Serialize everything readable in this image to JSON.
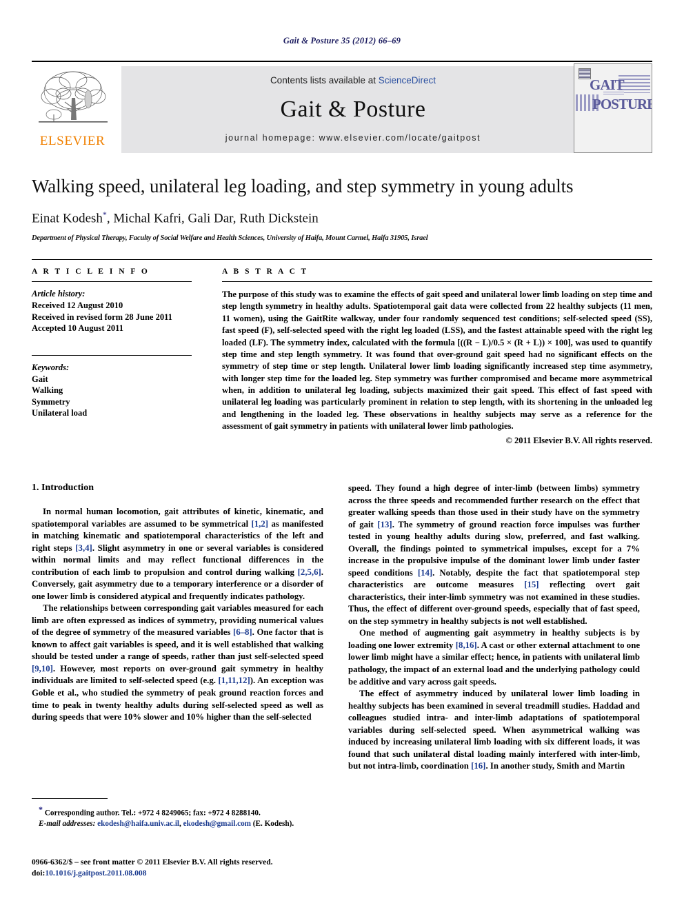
{
  "running_head": "Gait & Posture 35 (2012) 66–69",
  "masthead": {
    "contents_prefix": "Contents lists available at ",
    "sciencedirect": "ScienceDirect",
    "journal_title": "Gait & Posture",
    "homepage": "journal homepage: www.elsevier.com/locate/gaitpost",
    "publisher_wordmark": "ELSEVIER",
    "cover_title_line1": "GAIT",
    "cover_title_line2": "POSTURE",
    "accent_orange": "#f08000",
    "link_blue": "#2a4fa0",
    "band_gray": "#e4e4e6",
    "cover_purple": "#5a5a9a"
  },
  "article": {
    "title": "Walking speed, unilateral leg loading, and step symmetry in young adults",
    "authors": "Einat Kodesh",
    "authors_rest": ", Michal Kafri, Gali Dar, Ruth Dickstein",
    "affiliation": "Department of Physical Therapy, Faculty of Social Welfare and Health Sciences, University of Haifa, Mount Carmel, Haifa 31905, Israel"
  },
  "info": {
    "heading": "A R T I C L E    I N F O",
    "history_label": "Article history:",
    "history": [
      "Received 12 August 2010",
      "Received in revised form 28 June 2011",
      "Accepted 10 August 2011"
    ],
    "keywords_label": "Keywords:",
    "keywords": [
      "Gait",
      "Walking",
      "Symmetry",
      "Unilateral load"
    ]
  },
  "abstract": {
    "heading": "A B S T R A C T",
    "text": "The purpose of this study was to examine the effects of gait speed and unilateral lower limb loading on step time and step length symmetry in healthy adults. Spatiotemporal gait data were collected from 22 healthy subjects (11 men, 11 women), using the GaitRite walkway, under four randomly sequenced test conditions; self-selected speed (SS), fast speed (F), self-selected speed with the right leg loaded (LSS), and the fastest attainable speed with the right leg loaded (LF). The symmetry index, calculated with the formula [((R − L)/0.5 × (R + L)) × 100], was used to quantify step time and step length symmetry. It was found that over-ground gait speed had no significant effects on the symmetry of step time or step length. Unilateral lower limb loading significantly increased step time asymmetry, with longer step time for the loaded leg. Step symmetry was further compromised and became more asymmetrical when, in addition to unilateral leg loading, subjects maximized their gait speed. This effect of fast speed with unilateral leg loading was particularly prominent in relation to step length, with its shortening in the unloaded leg and lengthening in the loaded leg. These observations in healthy subjects may serve as a reference for the assessment of gait symmetry in patients with unilateral lower limb pathologies.",
    "copyright": "© 2011 Elsevier B.V. All rights reserved."
  },
  "body": {
    "section_heading": "1. Introduction",
    "left_paragraphs": [
      {
        "segments": [
          {
            "t": "In normal human locomotion, gait attributes of kinetic, kinematic, and spatiotemporal variables are assumed to be symmetrical "
          },
          {
            "t": "[1,2]",
            "ref": true
          },
          {
            "t": " as manifested in matching kinematic and spatiotemporal characteristics of the left and right steps "
          },
          {
            "t": "[3,4]",
            "ref": true
          },
          {
            "t": ". Slight asymmetry in one or several variables is considered within normal limits and may reflect functional differences in the contribution of each limb to propulsion and control during walking "
          },
          {
            "t": "[2,5,6]",
            "ref": true
          },
          {
            "t": ". Conversely, gait asymmetry due to a temporary interference or a disorder of one lower limb is considered atypical and frequently indicates pathology."
          }
        ]
      },
      {
        "segments": [
          {
            "t": "The relationships between corresponding gait variables measured for each limb are often expressed as indices of symmetry, providing numerical values of the degree of symmetry of the measured variables "
          },
          {
            "t": "[6–8]",
            "ref": true
          },
          {
            "t": ". One factor that is known to affect gait variables is speed, and it is well established that walking should be tested under a range of speeds, rather than just self-selected speed "
          },
          {
            "t": "[9,10]",
            "ref": true
          },
          {
            "t": ". However, most reports on over-ground gait symmetry in healthy individuals are limited to self-selected speed (e.g. "
          },
          {
            "t": "[1,11,12]",
            "ref": true
          },
          {
            "t": "). An exception was Goble et  al., who studied the symmetry of peak ground reaction forces and time to peak in twenty healthy adults during self-selected speed as well as during speeds that were 10% slower and 10% higher than the self-selected"
          }
        ]
      }
    ],
    "right_paragraphs": [
      {
        "continuation": true,
        "segments": [
          {
            "t": "speed. They found a high degree of inter-limb (between limbs) symmetry across the three speeds and recommended further research on the effect that greater walking speeds than those used in their study have on the symmetry of gait "
          },
          {
            "t": "[13]",
            "ref": true
          },
          {
            "t": ". The symmetry of ground reaction force impulses was further tested in young healthy adults during slow, preferred, and fast walking. Overall, the findings pointed to symmetrical impulses, except for a 7% increase in the propulsive impulse of the dominant lower limb under faster speed conditions "
          },
          {
            "t": "[14]",
            "ref": true
          },
          {
            "t": ". Notably, despite the fact that spatiotemporal step characteristics are outcome measures "
          },
          {
            "t": "[15]",
            "ref": true
          },
          {
            "t": " reflecting overt gait characteristics, their inter-limb symmetry was not examined in these studies. Thus, the effect of different over-ground speeds, especially that of fast speed, on the step symmetry in healthy subjects is not well established."
          }
        ]
      },
      {
        "segments": [
          {
            "t": "One method of augmenting gait asymmetry in healthy subjects is by loading one lower extremity "
          },
          {
            "t": "[8,16]",
            "ref": true
          },
          {
            "t": ". A cast or other external attachment to one lower limb might have a similar effect; hence, in patients with unilateral limb pathology, the impact of an external load and the underlying pathology could be additive and vary across gait speeds."
          }
        ]
      },
      {
        "segments": [
          {
            "t": "The effect of asymmetry induced by unilateral lower limb loading in healthy subjects has been examined in several treadmill studies. Haddad and colleagues studied intra- and inter-limb adaptations of spatiotemporal variables during self-selected speed. When asymmetrical walking was induced by increasing unilateral limb loading with six different loads, it was found that such unilateral distal loading mainly interfered with inter-limb, but not intra-limb, coordination "
          },
          {
            "t": "[16]",
            "ref": true
          },
          {
            "t": ". In another study, Smith and Martin"
          }
        ]
      }
    ]
  },
  "footnote": {
    "star": "*",
    "corresponding": " Corresponding author. Tel.: +972 4 8249065; fax: +972 4 8288140.",
    "email_label": "E-mail addresses:",
    "email1": "ekodesh@haifa.univ.ac.il",
    "email_sep": ", ",
    "email2": "ekodesh@gmail.com",
    "email_suffix": " (E. Kodesh)."
  },
  "footer": {
    "issn_line": "0966-6362/$ – see front matter © 2011 Elsevier B.V. All rights reserved.",
    "doi_label": "doi:",
    "doi_value": "10.1016/j.gaitpost.2011.08.008"
  }
}
